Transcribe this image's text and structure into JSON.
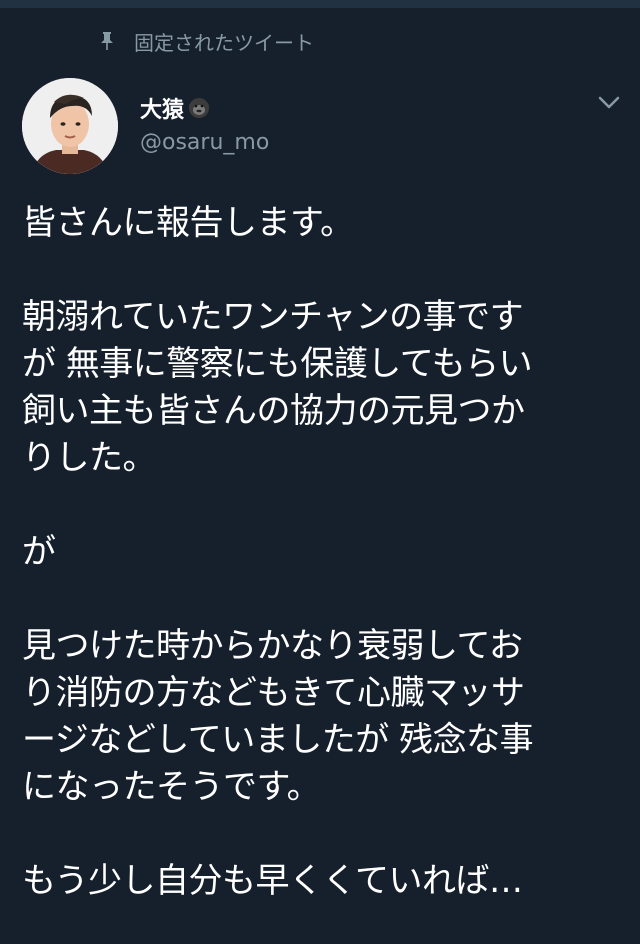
{
  "header": {
    "pinned_label": "固定されたツイート"
  },
  "user": {
    "display_name": "大猿",
    "handle": "@osaru_mo"
  },
  "tweet": {
    "lines": [
      "皆さんに報告します。",
      "",
      "朝溺れていたワンチャンの事です",
      "が 無事に警察にも保護してもらい",
      "飼い主も皆さんの協力の元見つか",
      "りした。",
      "",
      "が",
      "",
      "見つけた時からかなり衰弱してお",
      "り消防の方などもきて心臓マッサ",
      "ージなどしていましたが 残念な事",
      "になったそうです。",
      "",
      "もう少し自分も早くくていれば…"
    ]
  },
  "colors": {
    "background": "#16202c",
    "secondary_text": "#8899a6",
    "primary_text": "#ffffff"
  },
  "icons": {
    "pin": "pin-icon",
    "verified_emoji": "gorilla-icon",
    "menu": "chevron-down-icon"
  }
}
